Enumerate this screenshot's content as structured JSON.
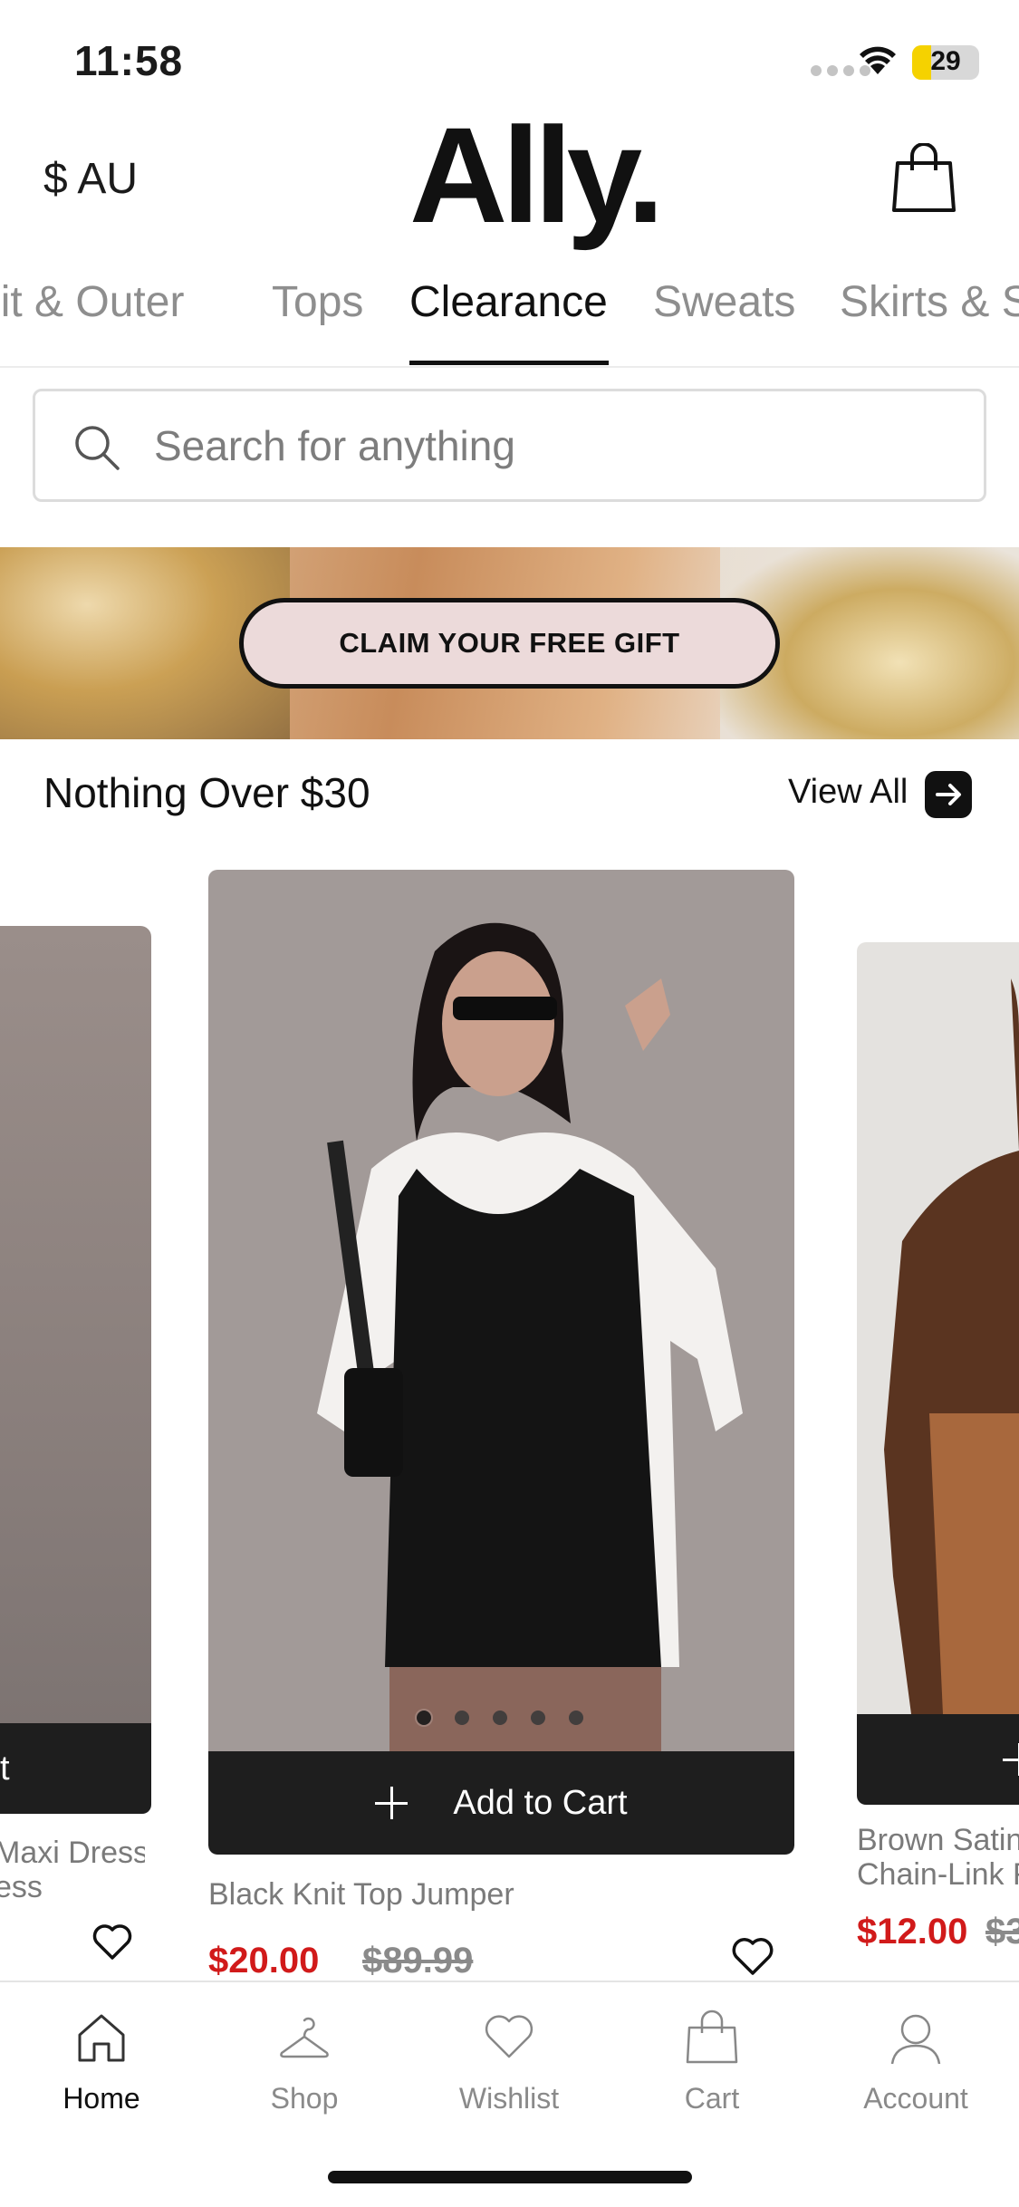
{
  "status_bar": {
    "time": "11:58",
    "battery": "29",
    "battery_level": 0.29
  },
  "header": {
    "currency": "$ AU",
    "logo": "Ally."
  },
  "tabs": [
    {
      "label": "Knit & Outer",
      "active": false
    },
    {
      "label": "Tops",
      "active": false
    },
    {
      "label": "Clearance",
      "active": true
    },
    {
      "label": "Sweats",
      "active": false
    },
    {
      "label": "Skirts & Shorts",
      "active": false
    }
  ],
  "search": {
    "placeholder": "Search for anything"
  },
  "banner": {
    "button_label": "CLAIM YOUR FREE GIFT"
  },
  "section": {
    "title": "Nothing Over $30",
    "view_all": "View All"
  },
  "products": [
    {
      "name_line1": "Maxi Dress",
      "name_line2": "ess",
      "add_label": "t"
    },
    {
      "name": "Black Knit Top Jumper",
      "price": "$20.00",
      "old_price": "$89.99",
      "add_label": "Add to Cart",
      "image_index": 1,
      "image_count": 5
    },
    {
      "name_line1": "Brown Satin",
      "name_line2": "Chain-Link F",
      "price": "$12.00",
      "old_price": "$3"
    }
  ],
  "bottom_nav": [
    {
      "label": "Home",
      "icon": "home-icon",
      "active": true
    },
    {
      "label": "Shop",
      "icon": "hanger-icon",
      "active": false
    },
    {
      "label": "Wishlist",
      "icon": "heart-icon",
      "active": false
    },
    {
      "label": "Cart",
      "icon": "bag-icon",
      "active": false
    },
    {
      "label": "Account",
      "icon": "user-icon",
      "active": false
    }
  ],
  "colors": {
    "sale_red": "#d11a1a",
    "dark": "#1e1e1e",
    "banner_button": "#ecdada",
    "battery": "#f5d200"
  }
}
